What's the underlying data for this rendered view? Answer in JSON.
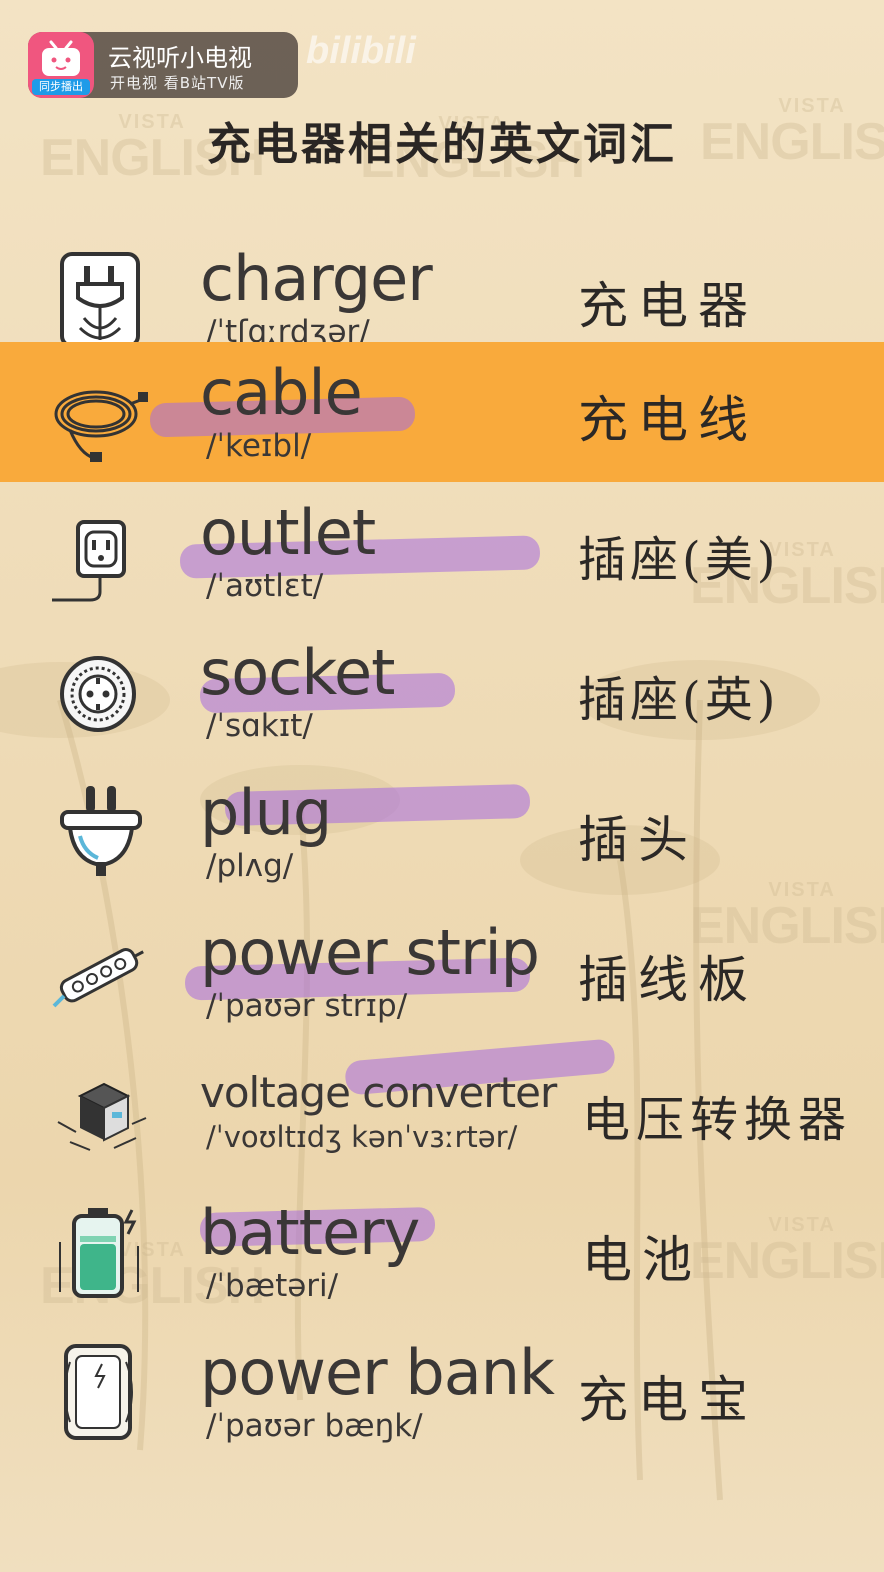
{
  "app": {
    "name": "云视听小电视",
    "subtitle": "开电视 看B站TV版",
    "sync_badge": "同步播出",
    "watermark": "bilibili",
    "brand_color": "#f0567f"
  },
  "page": {
    "title": "充电器相关的英文词汇",
    "highlight_color": "#f9aa3c"
  },
  "background_watermark": {
    "line1": "VISTA",
    "line2": "ENGLISH"
  },
  "vocab": [
    {
      "word": "charger",
      "ipa": "/ˈtʃɑːrdʒər/",
      "zh": "充电器",
      "icon": "charger-icon"
    },
    {
      "word": "cable",
      "ipa": "/ˈkeɪbl/",
      "zh": "充电线",
      "icon": "cable-icon"
    },
    {
      "word": "outlet",
      "ipa": "/ˈaʊtlɛt/",
      "zh": "插座(美)",
      "icon": "outlet-icon"
    },
    {
      "word": "socket",
      "ipa": "/ˈsɑkɪt/",
      "zh": "插座(英)",
      "icon": "socket-icon"
    },
    {
      "word": "plug",
      "ipa": "/plʌg/",
      "zh": "插头",
      "icon": "plug-icon"
    },
    {
      "word": "power strip",
      "ipa": "/ˈpaʊər strɪp/",
      "zh": "插线板",
      "icon": "power-strip-icon"
    },
    {
      "word": "voltage converter",
      "ipa": "/ˈvoʊltɪdʒ kənˈvɜːrtər/",
      "zh": "电压转换器",
      "icon": "voltage-converter-icon"
    },
    {
      "word": "battery",
      "ipa": "/ˈbætəri/",
      "zh": "电池",
      "icon": "battery-icon"
    },
    {
      "word": "power bank",
      "ipa": "/ˈpaʊər bæŋk/",
      "zh": "充电宝",
      "icon": "power-bank-icon"
    }
  ]
}
